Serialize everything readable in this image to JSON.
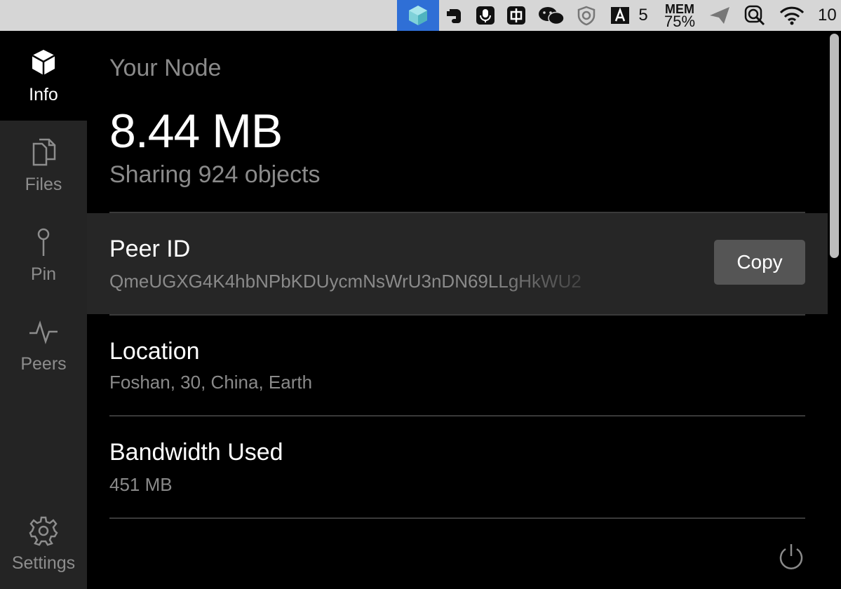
{
  "menubar": {
    "badge_count": "5",
    "mem_label": "MEM",
    "mem_value": "75%",
    "clock_partial": "10"
  },
  "sidebar": {
    "items": [
      {
        "label": "Info",
        "icon": "cube-icon"
      },
      {
        "label": "Files",
        "icon": "files-icon"
      },
      {
        "label": "Pin",
        "icon": "pin-icon"
      },
      {
        "label": "Peers",
        "icon": "pulse-icon"
      }
    ],
    "settings": {
      "label": "Settings",
      "icon": "gear-icon"
    }
  },
  "node": {
    "title": "Your Node",
    "size": "8.44 MB",
    "sharing": "Sharing 924 objects"
  },
  "peer": {
    "title": "Peer ID",
    "value": "QmeUGXG4K4hbNPbKDUycmNsWrU3nDN69LLgHkWU2",
    "copy_label": "Copy"
  },
  "location": {
    "title": "Location",
    "value": "Foshan, 30, China, Earth"
  },
  "bandwidth": {
    "title": "Bandwidth Used",
    "value": "451 MB"
  },
  "colors": {
    "sidebar_bg": "#242424",
    "peer_bg": "#262626",
    "copy_bg": "#555555",
    "muted_text": "#8a8a8a",
    "active_app_bg": "#2f6fd6"
  }
}
